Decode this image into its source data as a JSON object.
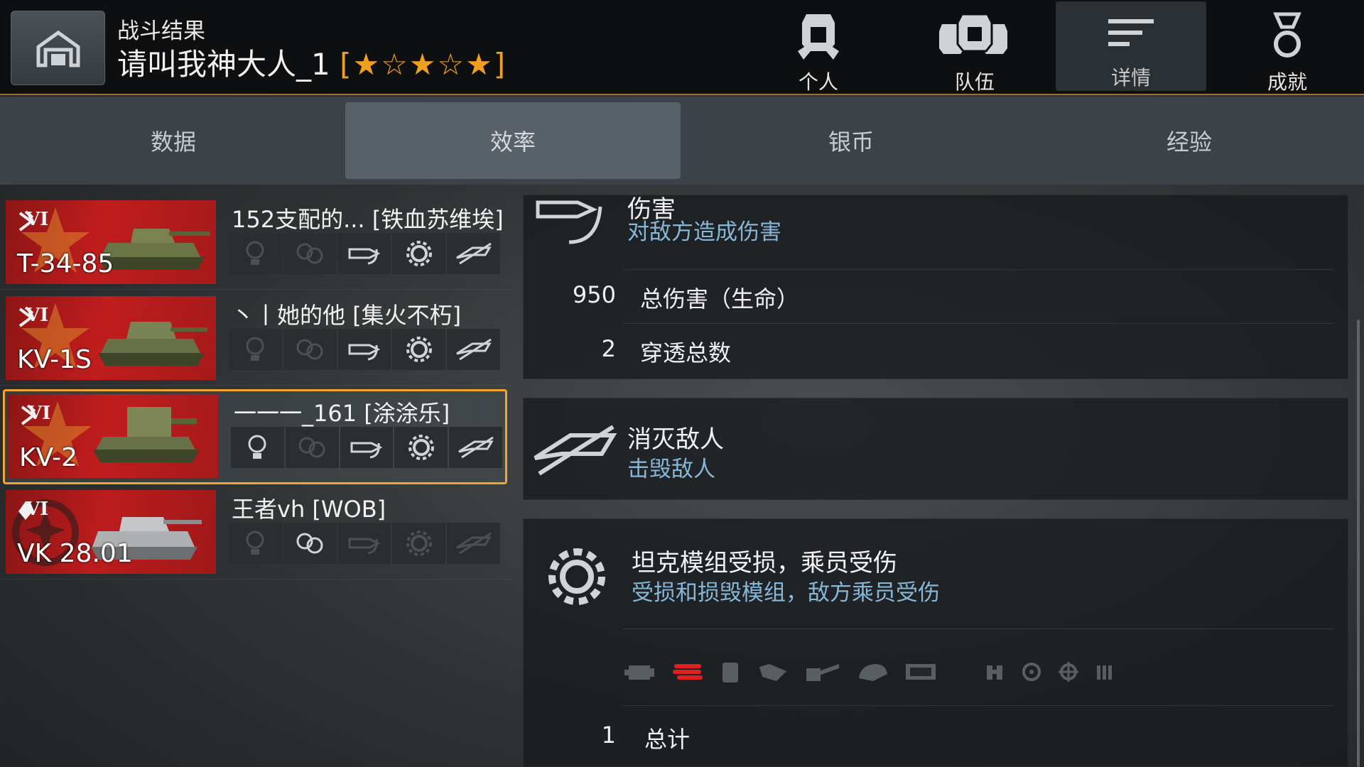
{
  "header": {
    "subtitle": "战斗结果",
    "player": "请叫我神大人_1",
    "rank": "[★☆★☆★]",
    "nav": [
      {
        "label": "个人",
        "icon": "personal-helmet-icon"
      },
      {
        "label": "队伍",
        "icon": "team-helmets-icon"
      },
      {
        "label": "详情",
        "icon": "details-list-icon",
        "active": true
      },
      {
        "label": "成就",
        "icon": "achievement-medal-icon"
      }
    ]
  },
  "subtabs": [
    "数据",
    "效率",
    "银币",
    "经验"
  ],
  "vehicles": [
    {
      "tier": "VI",
      "tank": "T-34-85",
      "player": "152支配的...  [铁血苏维埃]",
      "nation": "ussr",
      "medals": [
        false,
        false,
        true,
        true,
        true
      ]
    },
    {
      "tier": "VI",
      "tank": "KV-1S",
      "player": "丶丨她的他 [集火不朽]",
      "nation": "ussr",
      "medals": [
        false,
        false,
        true,
        true,
        true
      ]
    },
    {
      "tier": "VI",
      "tank": "KV-2",
      "player": "一一一_161 [涂涂乐]",
      "nation": "ussr",
      "selected": true,
      "medals": [
        true,
        false,
        true,
        true,
        true
      ]
    },
    {
      "tier": "VI",
      "tank": "VK 28.01",
      "player": "王者vh [WOB]",
      "nation": "germany",
      "medals": [
        false,
        true,
        false,
        false,
        false
      ]
    }
  ],
  "damage_panel": {
    "title": "伤害",
    "desc": "对敌方造成伤害",
    "rows": [
      {
        "value": "950",
        "label": "总伤害（生命）"
      },
      {
        "value": "2",
        "label": "穿透总数"
      }
    ]
  },
  "kill_panel": {
    "title": "消灭敌人",
    "desc": "击毁敌人"
  },
  "module_panel": {
    "title": "坦克模组受损，乘员受伤",
    "desc": "受损和损毁模组，敌方乘员受伤",
    "modules": [
      "engine-icon",
      "tracks-icon",
      "fuel-tank-icon",
      "ammo-rack-icon",
      "gun-icon",
      "turret-icon",
      "radio-icon",
      "commander-icon",
      "driver-icon",
      "gunner-icon",
      "loader-icon"
    ],
    "hit_module": "tracks-icon",
    "total": {
      "value": "1",
      "label": "总计"
    }
  },
  "colors": {
    "accent": "#f1a530",
    "desc": "#86b6d8",
    "tank_card": "#c01d1d",
    "hit": "#e02020"
  }
}
